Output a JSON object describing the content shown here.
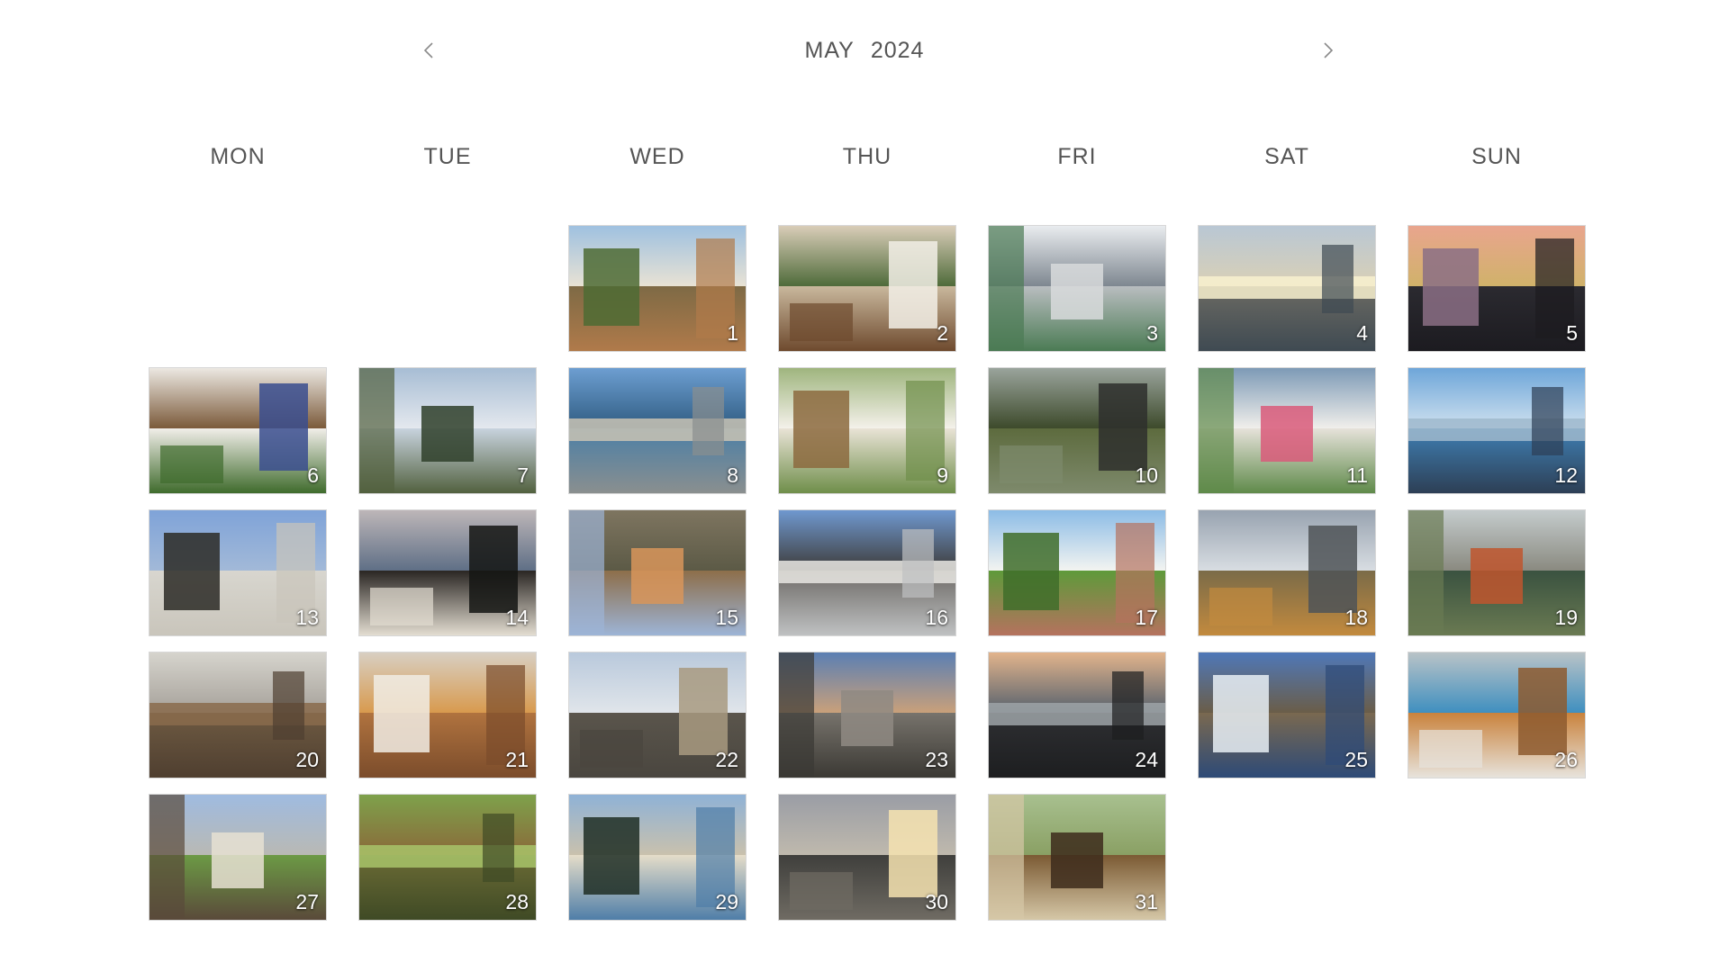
{
  "header": {
    "month": "MAY",
    "year": "2024",
    "prev_icon": "chevron-left-icon",
    "next_icon": "chevron-right-icon"
  },
  "weekdays": [
    "MON",
    "TUE",
    "WED",
    "THU",
    "FRI",
    "SAT",
    "SUN"
  ],
  "leading_empty_cells": 2,
  "days": [
    {
      "day": "1",
      "scene": "italian-balcony-view",
      "sky": "#9fc1e0",
      "ground": "#7e6a45",
      "a": "#4d6b34",
      "b": "#b07a4a",
      "c": "#e8e2d4"
    },
    {
      "day": "2",
      "scene": "cozy-bedroom",
      "sky": "#d9cdb8",
      "ground": "#c9b89d",
      "a": "#f2eee6",
      "b": "#6e4a2e",
      "c": "#4f6b3a"
    },
    {
      "day": "3",
      "scene": "apartment-building",
      "sky": "#e9ecef",
      "ground": "#b9bdc0",
      "a": "#d8dadc",
      "b": "#4b7b54",
      "c": "#7e8790"
    },
    {
      "day": "4",
      "scene": "beach-sunset-couple",
      "sky": "#b9c7d4",
      "ground": "#6b6a63",
      "a": "#f8f1cf",
      "b": "#3f4a52",
      "c": "#d9d0b6"
    },
    {
      "day": "5",
      "scene": "city-dusk",
      "sky": "#e9a58e",
      "ground": "#2b2a30",
      "a": "#8b6f85",
      "b": "#1c1b20",
      "c": "#d0b26a"
    },
    {
      "day": "6",
      "scene": "book-and-plant",
      "sky": "#ece8e2",
      "ground": "#f1eee9",
      "a": "#3a4d8f",
      "b": "#3f6b2c",
      "c": "#7b5a3a"
    },
    {
      "day": "7",
      "scene": "tree-and-sky",
      "sky": "#a7bdd4",
      "ground": "#c8d3de",
      "a": "#2f3f2a",
      "b": "#52613f",
      "c": "#e4e8ee"
    },
    {
      "day": "8",
      "scene": "harbor-city",
      "sky": "#6d9ed1",
      "ground": "#4b7fa6",
      "a": "#c9c3b4",
      "b": "#8a8f8f",
      "c": "#2f5c82"
    },
    {
      "day": "9",
      "scene": "kitchen-window",
      "sky": "#9fb57e",
      "ground": "#e9e3d6",
      "a": "#8c6a3e",
      "b": "#6f8e4a",
      "c": "#f4f1ea"
    },
    {
      "day": "10",
      "scene": "window-green",
      "sky": "#9aa49c",
      "ground": "#5d6b3e",
      "a": "#2e2f2d",
      "b": "#7e8a6c",
      "c": "#3d4a2b"
    },
    {
      "day": "11",
      "scene": "window-flowers",
      "sky": "#7d9ab6",
      "ground": "#e6e2da",
      "a": "#d95a7a",
      "b": "#5f8a4a",
      "c": "#f1efeb"
    },
    {
      "day": "12",
      "scene": "ocean-skyline",
      "sky": "#6ea6d9",
      "ground": "#3f7fb3",
      "a": "#9fb9cd",
      "b": "#2d3f55",
      "c": "#cfe1ef"
    },
    {
      "day": "13",
      "scene": "branches-building",
      "sky": "#7fa3d8",
      "ground": "#d8d6cf",
      "a": "#2b2a26",
      "b": "#c9c5bb",
      "c": "#a2b9d8"
    },
    {
      "day": "14",
      "scene": "palm-villa-dusk",
      "sky": "#bdb6b8",
      "ground": "#2a2623",
      "a": "#141513",
      "b": "#e3ddd1",
      "c": "#5f6f86"
    },
    {
      "day": "15",
      "scene": "cat-on-rocks",
      "sky": "#7e7560",
      "ground": "#8d6e4a",
      "a": "#d8955a",
      "b": "#9db4d6",
      "c": "#5c5a46"
    },
    {
      "day": "16",
      "scene": "city-towers",
      "sky": "#6f98cf",
      "ground": "#6d6a66",
      "a": "#e9e7e3",
      "b": "#bfc1c2",
      "c": "#3e3c3a"
    },
    {
      "day": "17",
      "scene": "garden-villa",
      "sky": "#8cbce6",
      "ground": "#5e9a3a",
      "a": "#3f6d2a",
      "b": "#b5725e",
      "c": "#f3f4f1"
    },
    {
      "day": "18",
      "scene": "modern-tower",
      "sky": "#98a3b0",
      "ground": "#7a6b48",
      "a": "#4f5357",
      "b": "#c28a3e",
      "c": "#d8dde2"
    },
    {
      "day": "19",
      "scene": "stone-bridge-river",
      "sky": "#c4cbcc",
      "ground": "#3a5240",
      "a": "#c0562e",
      "b": "#6a7a52",
      "c": "#8a8a80"
    },
    {
      "day": "20",
      "scene": "old-stone-buildings",
      "sky": "#d6d4cd",
      "ground": "#6e5a42",
      "a": "#8a6b4c",
      "b": "#4f3f30",
      "c": "#a6a19a"
    },
    {
      "day": "21",
      "scene": "loft-interior",
      "sky": "#d8cfc2",
      "ground": "#b0733f",
      "a": "#f1ece4",
      "b": "#7b4c2b",
      "c": "#d89a4e"
    },
    {
      "day": "22",
      "scene": "street-bridge",
      "sky": "#b9c9dc",
      "ground": "#5a554c",
      "a": "#a89a80",
      "b": "#4a463f",
      "c": "#e0e5ea"
    },
    {
      "day": "23",
      "scene": "waterfront-evening",
      "sky": "#5b7fb3",
      "ground": "#77736c",
      "a": "#8f8a82",
      "b": "#3b3934",
      "c": "#c9a07a"
    },
    {
      "day": "24",
      "scene": "monitors-city-dusk",
      "sky": "#e2b48c",
      "ground": "#2e2f32",
      "a": "#9ea3a7",
      "b": "#1d1e20",
      "c": "#56616d"
    },
    {
      "day": "25",
      "scene": "mount-fuji-lake",
      "sky": "#4f78b8",
      "ground": "#7a6950",
      "a": "#e8eef4",
      "b": "#2d4a77",
      "c": "#6a5d48"
    },
    {
      "day": "26",
      "scene": "cat-window",
      "sky": "#b9c3c7",
      "ground": "#c9823c",
      "a": "#8d5a2f",
      "b": "#e7e3dc",
      "c": "#3f8fbf"
    },
    {
      "day": "27",
      "scene": "park-palace",
      "sky": "#9fbbe0",
      "ground": "#6c9a45",
      "a": "#e6e0d2",
      "b": "#5a4a3a",
      "c": "#b9b9b4"
    },
    {
      "day": "28",
      "scene": "pond-trees",
      "sky": "#7ea14b",
      "ground": "#6b6b35",
      "a": "#a8c46a",
      "b": "#3f4a25",
      "c": "#8a6a3a"
    },
    {
      "day": "29",
      "scene": "pine-beach",
      "sky": "#8fb2d6",
      "ground": "#e5ddc9",
      "a": "#1f2e25",
      "b": "#4f7ea8",
      "c": "#c9c1ad"
    },
    {
      "day": "30",
      "scene": "ocean-sunrise",
      "sky": "#9a9da5",
      "ground": "#3f3f3c",
      "a": "#f6e3b0",
      "b": "#6f6b63",
      "c": "#bfb9ad"
    },
    {
      "day": "31",
      "scene": "doorway-garden",
      "sky": "#a8c08f",
      "ground": "#7b5a33",
      "a": "#3d2c1c",
      "b": "#d5c7a7",
      "c": "#8aa064"
    }
  ]
}
